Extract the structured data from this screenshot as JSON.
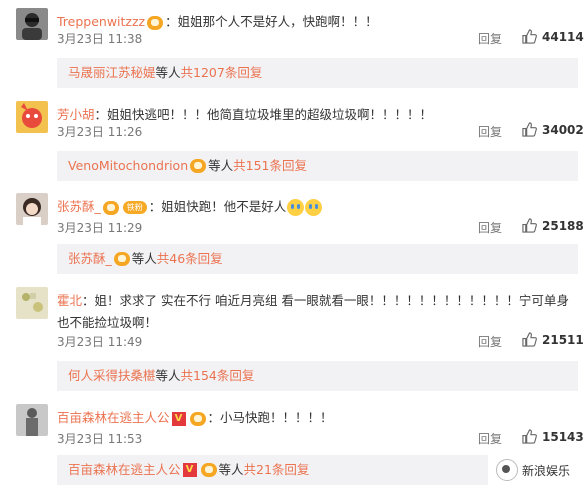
{
  "colors": {
    "username": "#eb7350",
    "meta": "#777777",
    "sub_bg": "#f2f2f5"
  },
  "labels": {
    "reply": "回复",
    "like_icon": "thumbs-up-icon"
  },
  "comments": [
    {
      "user": "Treppenwitzzz",
      "text": "：姐姐那个人不是好人，快跑啊！！！",
      "time": "3月23日 11:38",
      "likes": "44114",
      "sub": {
        "name": "马晟丽江苏秘媞",
        "etc": " 等人 ",
        "count": "共1207条回复"
      }
    },
    {
      "user": "芳小胡",
      "text": "：姐姐快逃吧！！！他简直垃圾堆里的超级垃圾啊！！！！！",
      "time": "3月23日 11:26",
      "likes": "34002",
      "sub": {
        "name": "VenoMitochondrion",
        "etc": " 等人 ",
        "count": "共151条回复"
      }
    },
    {
      "user": "张苏酥_",
      "badge": "铁粉",
      "text": "：姐姐快跑！他不是好人",
      "time": "3月23日 11:29",
      "likes": "25188",
      "sub": {
        "name": "张苏酥_",
        "etc": " 等人 ",
        "count": "共46条回复"
      }
    },
    {
      "user": "霍北",
      "text": "：姐！求求了 实在不行 咱近月亮组 看一眼就看一眼！！！！！！！！！！！！宁可单身也不能捡垃圾啊！",
      "time": "3月23日 11:49",
      "likes": "21511",
      "sub": {
        "name": "何人采得扶桑椹",
        "etc": " 等人 ",
        "count": "共154条回复"
      }
    },
    {
      "user": "百亩森林在逃主人公",
      "text": "：小马快跑！！！！！",
      "time": "3月23日 11:53",
      "likes": "15143",
      "sub": {
        "name": "百亩森林在逃主人公",
        "etc": " 等人 ",
        "count": "共21条回复"
      }
    }
  ],
  "watermark": "新浪娱乐"
}
